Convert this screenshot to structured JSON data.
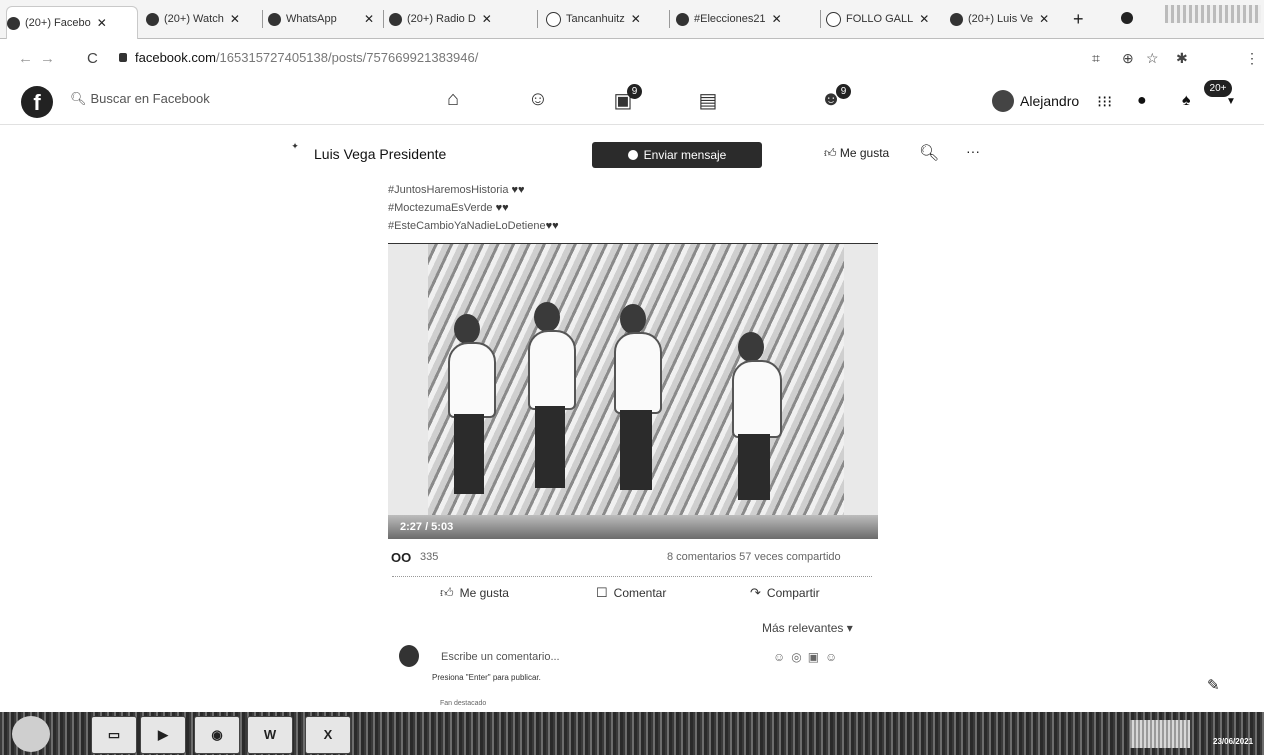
{
  "browser": {
    "tabs": [
      {
        "label": "(20+) Facebo",
        "close": "✕"
      },
      {
        "label": "(20+) Watch",
        "close": "✕"
      },
      {
        "label": "WhatsApp",
        "close": "✕"
      },
      {
        "label": "(20+) Radio D",
        "close": "✕"
      },
      {
        "label": "Tancanhuitz",
        "close": "✕"
      },
      {
        "label": "#Elecciones21",
        "close": "✕"
      },
      {
        "label": "FOLLO GALL",
        "close": "✕"
      },
      {
        "label": "(20+) Luis Ve",
        "close": "✕"
      }
    ],
    "newtab": "+",
    "url_domain": "facebook.com",
    "url_path": "/165315727405138/posts/757669921383946/"
  },
  "facebook": {
    "logo": "f",
    "search_placeholder": "Buscar en Facebook",
    "badges": {
      "watch": "9",
      "groups": "9",
      "notifications": "20+"
    },
    "user_name": "Alejandro"
  },
  "page": {
    "name": "Luis Vega Presidente",
    "message_btn": "Enviar mensaje",
    "like_btn": "Me gusta",
    "more": "···"
  },
  "post": {
    "lines": [
      "#JuntosHaremosHistoria",
      "#MoctezumaEsVerde",
      "#EsteCambioYaNadieLoDetiene"
    ],
    "video_time": "2:27 / 5:03",
    "reactions_count": "335",
    "stats": "8 comentarios  57 veces compartido",
    "actions": {
      "like": "Me gusta",
      "comment": "Comentar",
      "share": "Compartir"
    },
    "sort": "Más relevantes ▾",
    "comment_placeholder": "Escribe un comentario...",
    "comment_hint": "Presiona \"Enter\" para publicar.",
    "footer": "Fan destacado"
  },
  "taskbar": {
    "date": "23/06/2021"
  }
}
